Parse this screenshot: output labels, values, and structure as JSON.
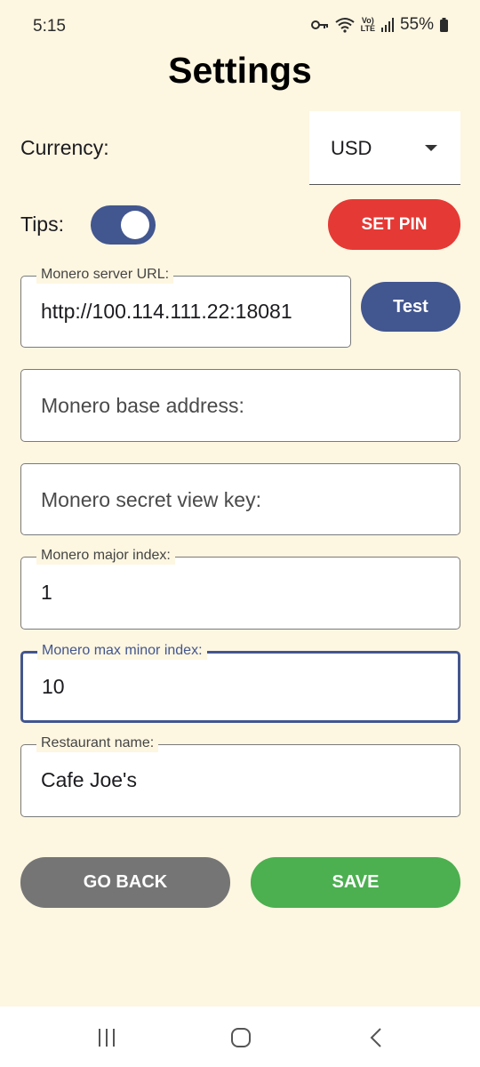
{
  "status_bar": {
    "time": "5:15",
    "battery_percent": "55%",
    "icons": [
      "key-icon",
      "wifi-icon",
      "volte-icon",
      "signal-icon",
      "battery-icon"
    ],
    "volte_text_top": "Vo)",
    "volte_text_bottom": "LTE"
  },
  "page": {
    "title": "Settings"
  },
  "currency": {
    "label": "Currency:",
    "selected": "USD"
  },
  "tips": {
    "label": "Tips:",
    "enabled": true
  },
  "buttons": {
    "set_pin": "SET PIN",
    "test": "Test",
    "go_back": "GO BACK",
    "save": "SAVE"
  },
  "fields": {
    "server_url": {
      "label": "Monero server URL:",
      "value": "http://100.114.111.22:18081"
    },
    "base_address": {
      "placeholder": "Monero base address:"
    },
    "secret_view_key": {
      "placeholder": "Monero secret view key:"
    },
    "major_index": {
      "label": "Monero major index:",
      "value": "1"
    },
    "max_minor_index": {
      "label": "Monero max minor index:",
      "value": "10"
    },
    "restaurant_name": {
      "label": "Restaurant name:",
      "value": "Cafe Joe's"
    }
  },
  "colors": {
    "background": "#fdf6e1",
    "primary": "#42568f",
    "danger": "#e53935",
    "success": "#4caf50",
    "neutral": "#757575"
  },
  "nav_bar": {
    "icons": [
      "recents-icon",
      "home-icon",
      "back-icon"
    ]
  }
}
